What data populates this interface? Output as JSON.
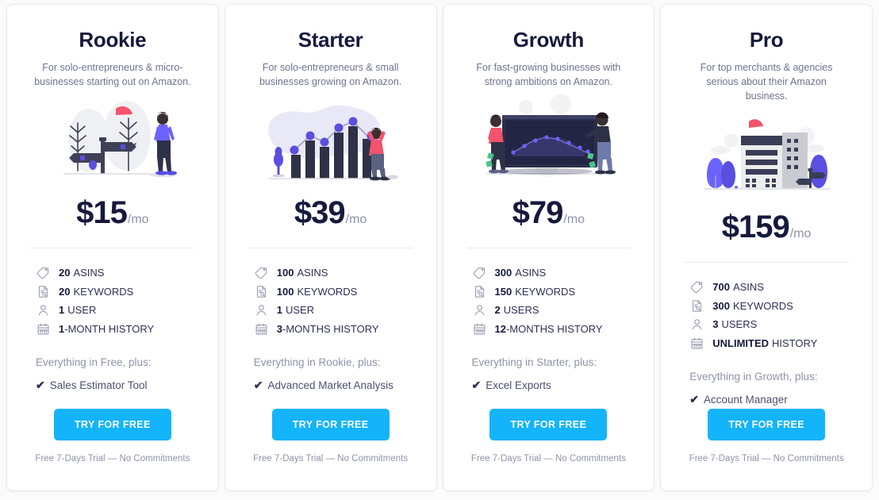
{
  "plans": [
    {
      "name": "Rookie",
      "description": "For solo-entrepreneurs & micro-businesses starting out on Amazon.",
      "price": "$15",
      "period": "/mo",
      "illustration": "signpost-person-illustration",
      "features": [
        {
          "icon": "tag-icon",
          "value": "20",
          "label": "ASINS"
        },
        {
          "icon": "document-search-icon",
          "value": "20",
          "label": "KEYWORDS"
        },
        {
          "icon": "user-icon",
          "value": "1",
          "label": "USER"
        },
        {
          "icon": "calendar-icon",
          "value": "1",
          "label": "-MONTH HISTORY",
          "tight": true
        }
      ],
      "everything": "Everything in Free, plus:",
      "extra": "Sales Estimator Tool",
      "cta": "TRY FOR FREE",
      "note": "Free 7-Days Trial — No Commitments"
    },
    {
      "name": "Starter",
      "description": "For solo-entrepreneurs & small businesses growing on Amazon.",
      "price": "$39",
      "period": "/mo",
      "illustration": "bar-chart-person-illustration",
      "features": [
        {
          "icon": "tag-icon",
          "value": "100",
          "label": "ASINS"
        },
        {
          "icon": "document-search-icon",
          "value": "100",
          "label": "KEYWORDS"
        },
        {
          "icon": "user-icon",
          "value": "1",
          "label": "USER"
        },
        {
          "icon": "calendar-icon",
          "value": "3",
          "label": "-MONTHS HISTORY",
          "tight": true
        }
      ],
      "everything": "Everything in Rookie, plus:",
      "extra": "Advanced Market Analysis",
      "cta": "TRY FOR FREE",
      "note": "Free 7-Days Trial — No Commitments"
    },
    {
      "name": "Growth",
      "description": "For fast-growing businesses with strong ambitions on Amazon.",
      "price": "$79",
      "period": "/mo",
      "illustration": "analytics-screen-people-illustration",
      "features": [
        {
          "icon": "tag-icon",
          "value": "300",
          "label": "ASINS"
        },
        {
          "icon": "document-search-icon",
          "value": "150",
          "label": "KEYWORDS"
        },
        {
          "icon": "user-icon",
          "value": "2",
          "label": "USERS"
        },
        {
          "icon": "calendar-icon",
          "value": "12",
          "label": "-MONTHS HISTORY",
          "tight": true
        }
      ],
      "everything": "Everything in Starter, plus:",
      "extra": "Excel Exports",
      "cta": "TRY FOR FREE",
      "note": "Free 7-Days Trial — No Commitments"
    },
    {
      "name": "Pro",
      "description": "For top merchants & agencies serious about their Amazon business.",
      "price": "$159",
      "period": "/mo",
      "illustration": "office-building-illustration",
      "features": [
        {
          "icon": "tag-icon",
          "value": "700",
          "label": "ASINS"
        },
        {
          "icon": "document-search-icon",
          "value": "300",
          "label": "KEYWORDS"
        },
        {
          "icon": "user-icon",
          "value": "3",
          "label": "USERS"
        },
        {
          "icon": "calendar-icon",
          "value": "UNLIMITED",
          "label": "HISTORY"
        }
      ],
      "everything": "Everything in Growth, plus:",
      "extra": "Account Manager",
      "cta": "TRY FOR FREE",
      "note": "Free 7-Days Trial — No Commitments"
    }
  ],
  "colors": {
    "cta_background": "#14b4fa",
    "title": "#151a3d",
    "muted_text": "#8e94a8",
    "accent_purple": "#5a4fe0",
    "accent_red": "#f2536d",
    "card_background": "#ffffff",
    "page_background": "#fbfbfc"
  }
}
